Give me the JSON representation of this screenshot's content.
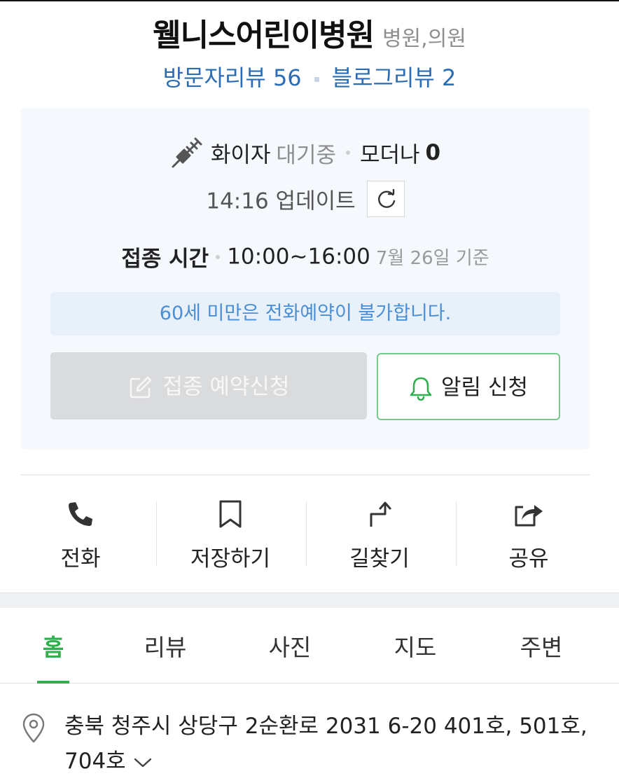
{
  "header": {
    "title": "웰니스어린이병원",
    "category": "병원,의원",
    "visitor_reviews": "방문자리뷰 56",
    "blog_reviews": "블로그리뷰 2"
  },
  "vaccine": {
    "name": "화이자",
    "status": "대기중",
    "name2": "모더나",
    "count2": "0",
    "update_time": "14:16 업데이트",
    "time_label": "접종 시간",
    "hours": "10:00~16:00",
    "basis": "7월 26일 기준",
    "notice": "60세 미만은 전화예약이 불가합니다.",
    "reserve_label": "접종 예약신청",
    "alert_label": "알림 신청"
  },
  "actions": {
    "call": "전화",
    "save": "저장하기",
    "directions": "길찾기",
    "share": "공유"
  },
  "tabs": [
    "홈",
    "리뷰",
    "사진",
    "지도",
    "주변"
  ],
  "active_tab": "홈",
  "address": {
    "text": "충북 청주시 상당구 2순환로 2031 6-20 401호, 501호, 704호"
  },
  "colors": {
    "accent_green": "#2fb04d",
    "link_blue": "#2c6cb5",
    "notice_blue": "#4a8fd6",
    "panel_bg": "#f5f8fc"
  }
}
